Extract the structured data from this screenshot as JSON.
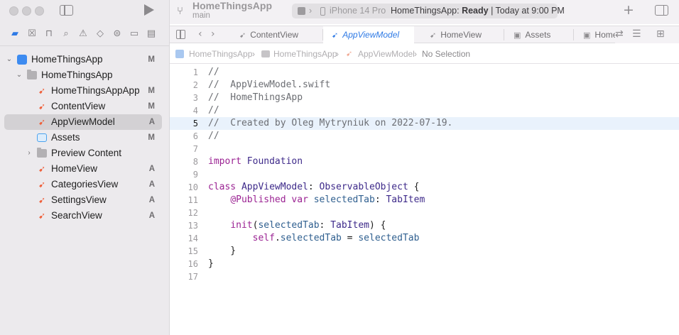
{
  "project_name": "HomeThingsApp",
  "branch": "main",
  "activity": {
    "destination": "iPhone 14 Pro",
    "status_prefix": "HomeThingsApp: ",
    "status_bold": "Ready",
    "status_suffix": " | Today at 9:00 PM"
  },
  "navigator": {
    "tools": [
      {
        "icon": "folder-icon"
      },
      {
        "icon": "source-control-icon"
      },
      {
        "icon": "symbol-icon"
      },
      {
        "icon": "find-icon"
      },
      {
        "icon": "issue-icon"
      },
      {
        "icon": "test-icon"
      },
      {
        "icon": "debug-icon"
      },
      {
        "icon": "breakpoint-icon"
      },
      {
        "icon": "report-icon"
      }
    ],
    "tree": [
      {
        "label": "HomeThingsApp",
        "status": "M",
        "kind": "project"
      },
      {
        "label": "HomeThingsApp",
        "status": "",
        "kind": "folder"
      },
      {
        "label": "HomeThingsAppApp",
        "status": "M",
        "kind": "swift"
      },
      {
        "label": "ContentView",
        "status": "M",
        "kind": "swift"
      },
      {
        "label": "AppViewModel",
        "status": "A",
        "kind": "swift"
      },
      {
        "label": "Assets",
        "status": "M",
        "kind": "assets"
      },
      {
        "label": "Preview Content",
        "status": "",
        "kind": "folder"
      },
      {
        "label": "HomeView",
        "status": "A",
        "kind": "swift"
      },
      {
        "label": "CategoriesView",
        "status": "A",
        "kind": "swift"
      },
      {
        "label": "SettingsView",
        "status": "A",
        "kind": "swift"
      },
      {
        "label": "SearchView",
        "status": "A",
        "kind": "swift"
      }
    ]
  },
  "tabs": [
    {
      "label": "ContentView"
    },
    {
      "label": "AppViewModel"
    },
    {
      "label": "HomeView"
    },
    {
      "label": "Assets"
    },
    {
      "label": "Home"
    }
  ],
  "jumpbar": {
    "project": "HomeThingsApp",
    "folder": "HomeThingsApp",
    "file": "AppViewModel",
    "selection": "No Selection"
  },
  "editor": {
    "current_line": 5,
    "lines": [
      {
        "n": "1",
        "text": "//"
      },
      {
        "n": "2",
        "text": "//  AppViewModel.swift"
      },
      {
        "n": "3",
        "text": "//  HomeThingsApp"
      },
      {
        "n": "4",
        "text": "//"
      },
      {
        "n": "5",
        "text": "//  Created by Oleg Mytryniuk on 2022-07-19."
      },
      {
        "n": "6",
        "text": "//"
      },
      {
        "n": "7",
        "text": ""
      },
      {
        "n": "8",
        "text": "import Foundation"
      },
      {
        "n": "9",
        "text": ""
      },
      {
        "n": "10",
        "text": "class AppViewModel: ObservableObject {"
      },
      {
        "n": "11",
        "text": "    @Published var selectedTab: TabItem"
      },
      {
        "n": "12",
        "text": ""
      },
      {
        "n": "13",
        "text": "    init(selectedTab: TabItem) {"
      },
      {
        "n": "14",
        "text": "        self.selectedTab = selectedTab"
      },
      {
        "n": "15",
        "text": "    }"
      },
      {
        "n": "16",
        "text": "}"
      },
      {
        "n": "17",
        "text": ""
      }
    ]
  }
}
